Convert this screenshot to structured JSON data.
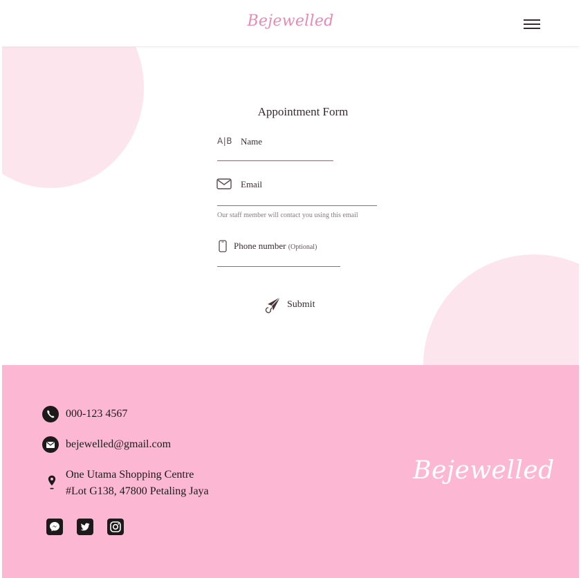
{
  "header": {
    "logo_text": "Bejewelled",
    "menu_icon": "hamburger-menu-icon"
  },
  "form": {
    "title": "Appointment Form",
    "name_label": "Name",
    "email_label": "Email",
    "email_hint": "Our staff member will contact you using this email",
    "phone_label": "Phone number",
    "phone_optional": "(Optional)",
    "ab_icon_text": "A|B",
    "submit_label": "Submit",
    "icons": [
      "ab-text-icon",
      "envelope-icon",
      "mobile-phone-icon",
      "paper-plane-icon"
    ]
  },
  "footer": {
    "phone": "000-123 4567",
    "email": "bejewelled@gmail.com",
    "address_line1": "One Utama Shopping Centre",
    "address_line2": "#Lot G138, 47800 Petaling Jaya",
    "logo_text": "Bejewelled",
    "social_icons": [
      "messenger-icon",
      "twitter-icon",
      "instagram-icon"
    ]
  },
  "colors": {
    "brand_pink": "#e98ab2",
    "footer_bg": "#fcb8d2",
    "blob_pink": "#fde5ee",
    "text_dark": "#3a2a2e"
  }
}
